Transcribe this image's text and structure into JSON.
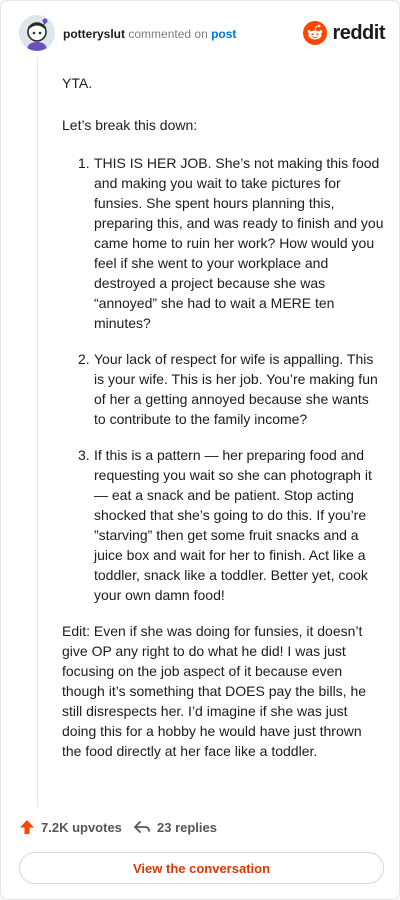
{
  "header": {
    "username": "potteryslut",
    "action_text": "commented on",
    "link_text": "post",
    "brand": "reddit"
  },
  "comment": {
    "opening": "YTA.",
    "intro": "Let’s break this down:",
    "items": [
      {
        "num": "1.",
        "text": "THIS IS HER JOB. She’s not making this food and making you wait to take pictures for funsies. She spent hours planning this, preparing this, and was ready to finish and you came home to ruin her work? How would you feel if she went to your workplace and destroyed a project because she was “annoyed” she had to wait a MERE ten minutes?"
      },
      {
        "num": "2.",
        "text": "Your lack of respect for wife is appalling. This is your wife. This is her job. You’re making fun of her a getting annoyed because she wants to contribute to the family income?"
      },
      {
        "num": "3.",
        "text": "If this is a pattern — her preparing food and requesting you wait so she can photograph it — eat a snack and be patient. Stop acting shocked that she’s going to do this. If you’re ”starving” then get some fruit snacks and a juice box and wait for her to finish. Act like a toddler, snack like a toddler. Better yet, cook your own damn food!"
      }
    ],
    "edit": "Edit: Even if she was doing for funsies, it doesn’t give OP any right to do what he did! I was just focusing on the job aspect of it because even though it’s something that DOES pay the bills, he still disrespects her. I’d imagine if she was just doing this for a hobby he would have just thrown the food directly at her face like a toddler."
  },
  "footer": {
    "upvotes": "7.2K upvotes",
    "replies": "23 replies",
    "cta": "View the conversation"
  },
  "colors": {
    "accent": "#d93a00",
    "reddit_orange": "#ff4500",
    "link": "#0079d3"
  },
  "icons": {
    "avatar": "avatar",
    "logo": "reddit-logo-icon",
    "upvote": "upvote-arrow-icon",
    "reply": "reply-arrow-icon"
  }
}
